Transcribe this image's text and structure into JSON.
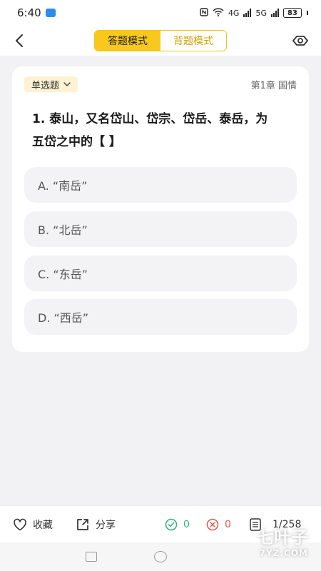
{
  "status_bar": {
    "time": "6:40",
    "net1": "4G",
    "net2": "5G",
    "battery": "83"
  },
  "header": {
    "tabs": [
      {
        "label": "答题模式",
        "active": true
      },
      {
        "label": "背题模式",
        "active": false
      }
    ]
  },
  "question": {
    "type_label": "单选题",
    "chapter": "第1章 国情",
    "text": "1. 泰山，又名岱山、岱宗、岱岳、泰岳，为五岱之中的【 】",
    "options": [
      {
        "label": "A. “南岳”"
      },
      {
        "label": "B. “北岳”"
      },
      {
        "label": "C. “东岳”"
      },
      {
        "label": "D. “西岳”"
      }
    ]
  },
  "bottom_bar": {
    "favorite_label": "收藏",
    "share_label": "分享",
    "correct_count": "0",
    "wrong_count": "0",
    "progress": "1/258"
  },
  "watermark": {
    "title": "七叶子",
    "sub": "7YZ.COM"
  },
  "colors": {
    "accent": "#f8c91c",
    "correct": "#2bb673",
    "wrong": "#e05a4e"
  }
}
